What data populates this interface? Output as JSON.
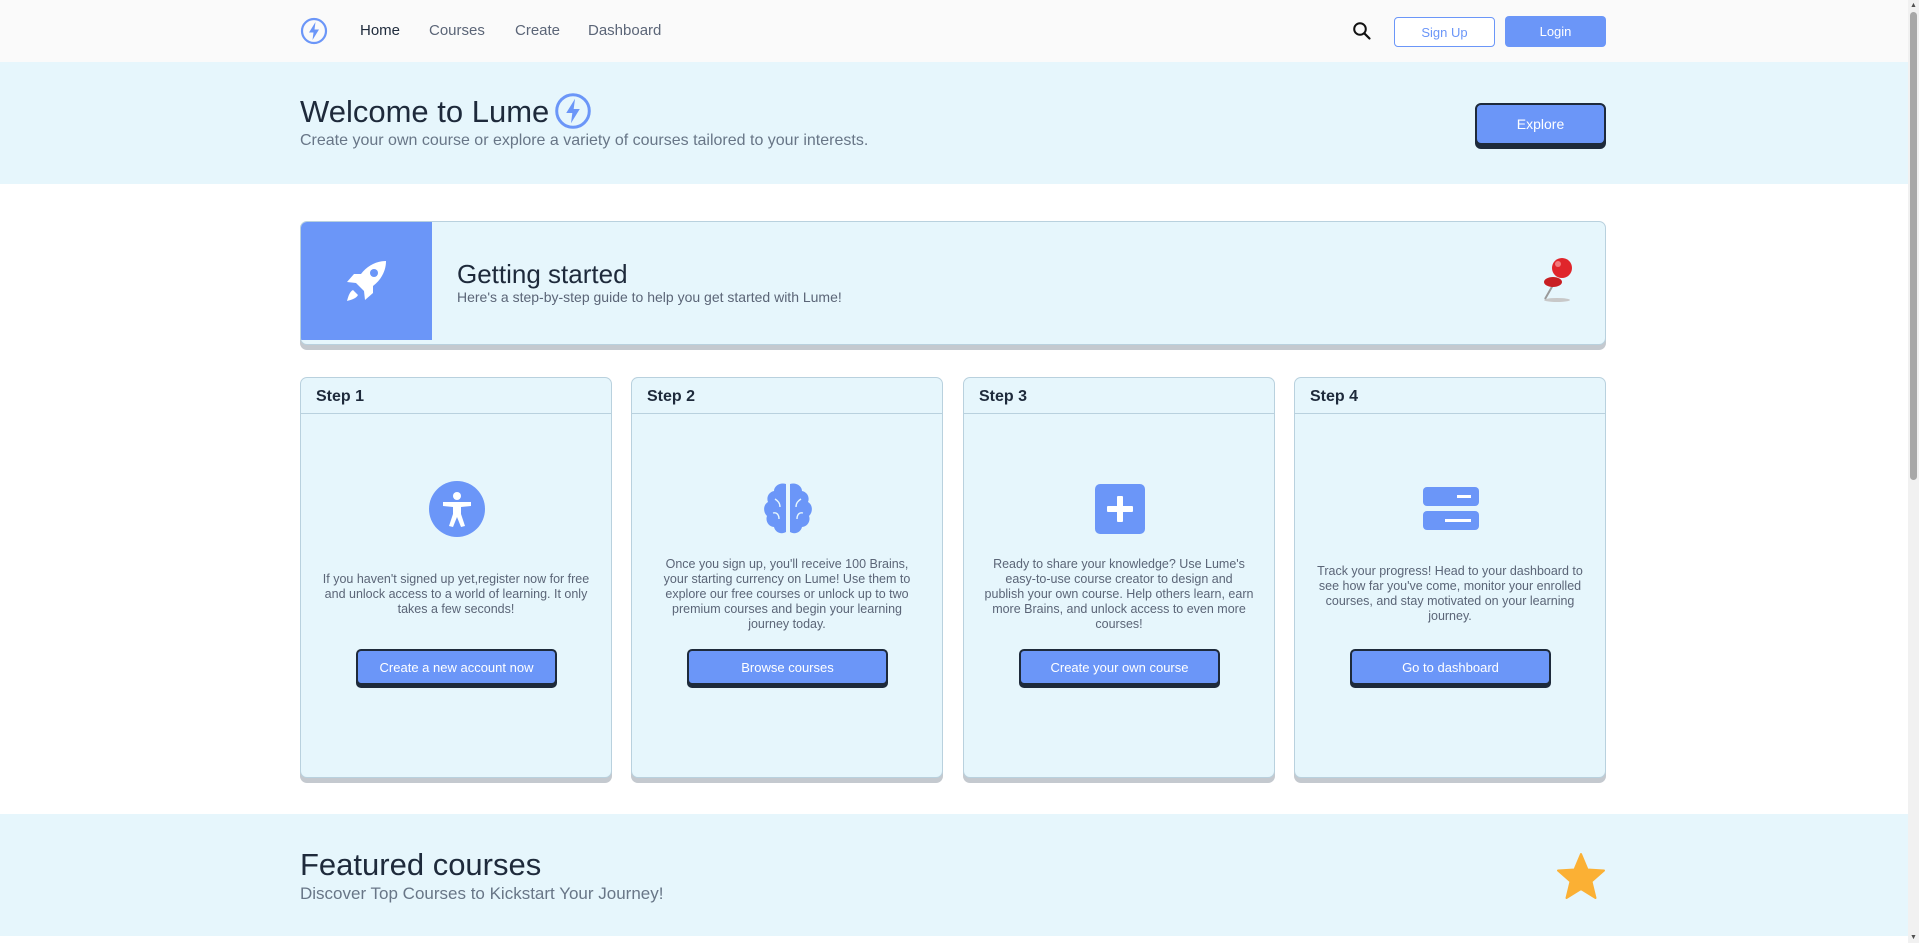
{
  "nav": {
    "logo_icon": "bolt-logo-icon",
    "links": [
      "Home",
      "Courses",
      "Create",
      "Dashboard"
    ],
    "active": "Home",
    "search_icon": "search-icon",
    "signup_label": "Sign Up",
    "login_label": "Login"
  },
  "hero": {
    "title": "Welcome to Lume",
    "subtitle": "Create your own course or explore a variety of courses tailored to your interests.",
    "explore_label": "Explore"
  },
  "getting_started": {
    "icon": "rocket-icon",
    "title": "Getting started",
    "subtitle": "Here's a step-by-step guide to help you get started with Lume!",
    "pin_icon": "pushpin-icon"
  },
  "steps": [
    {
      "header": "Step 1",
      "icon": "accessibility-icon",
      "text": "If you haven't signed up yet,register now for free and unlock access to a world of learning. It only takes a few seconds!",
      "button": "Create a new account now"
    },
    {
      "header": "Step 2",
      "icon": "brain-icon",
      "text": "Once you sign up, you'll receive 100 Brains, your starting currency on Lume! Use them to explore our free courses or unlock up to two premium courses and begin your learning journey today.",
      "button": "Browse courses"
    },
    {
      "header": "Step 3",
      "icon": "plus-square-icon",
      "text": "Ready to share your knowledge? Use Lume's easy-to-use course creator to design and publish your own course. Help others learn, earn more Brains, and unlock access to even more courses!",
      "button": "Create your own course"
    },
    {
      "header": "Step 4",
      "icon": "dashboard-bars-icon",
      "text": "Track your progress! Head to your dashboard to see how far you've come, monitor your enrolled courses, and stay motivated on your learning journey.",
      "button": "Go to dashboard"
    }
  ],
  "featured": {
    "title": "Featured courses",
    "subtitle": "Discover Top Courses to Kickstart Your Journey!",
    "star_icon": "star-icon"
  },
  "colors": {
    "accent": "#6b96f8",
    "hero_bg": "#e6f6fc",
    "text_dark": "#1e2a3b",
    "star": "#fbb034",
    "pin": "#e0252b"
  }
}
